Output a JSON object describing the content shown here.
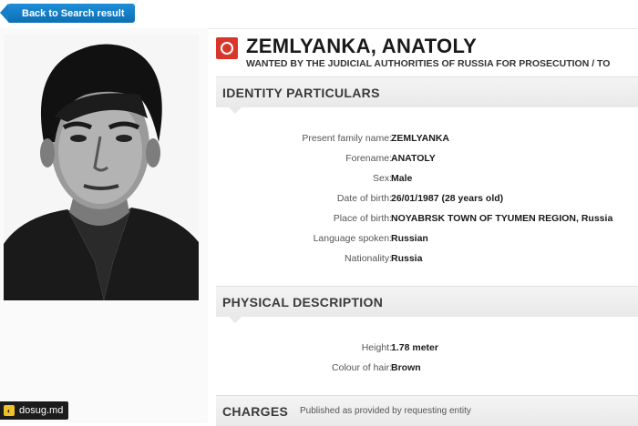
{
  "nav": {
    "back_label": "Back to Search result"
  },
  "notice": {
    "name": "ZEMLYANKA, ANATOLY",
    "wanted_by": "WANTED BY THE JUDICIAL AUTHORITIES OF RUSSIA FOR PROSECUTION / TO"
  },
  "sections": {
    "identity": "IDENTITY PARTICULARS",
    "physical": "PHYSICAL DESCRIPTION",
    "charges": "CHARGES",
    "charges_sub": "Published as provided by requesting entity"
  },
  "identity": [
    {
      "label": "Present family name:",
      "value": "ZEMLYANKA"
    },
    {
      "label": "Forename:",
      "value": "ANATOLY"
    },
    {
      "label": "Sex:",
      "value": "Male"
    },
    {
      "label": "Date of birth:",
      "value": "26/01/1987 (28 years old)"
    },
    {
      "label": "Place of birth:",
      "value": "NOYABRSK TOWN OF TYUMEN REGION, Russia"
    },
    {
      "label": "Language spoken:",
      "value": "Russian"
    },
    {
      "label": "Nationality:",
      "value": "Russia"
    }
  ],
  "physical": [
    {
      "label": "Height:",
      "value": "1.78 meter"
    },
    {
      "label": "Colour of hair:",
      "value": "Brown"
    }
  ],
  "watermark": {
    "text": "dosug.md"
  },
  "colors": {
    "accent": "#1a7fcc",
    "notice_red": "#d9362b"
  },
  "icons": {
    "notice": "red-notice-icon",
    "back": "arrow-left-icon"
  }
}
